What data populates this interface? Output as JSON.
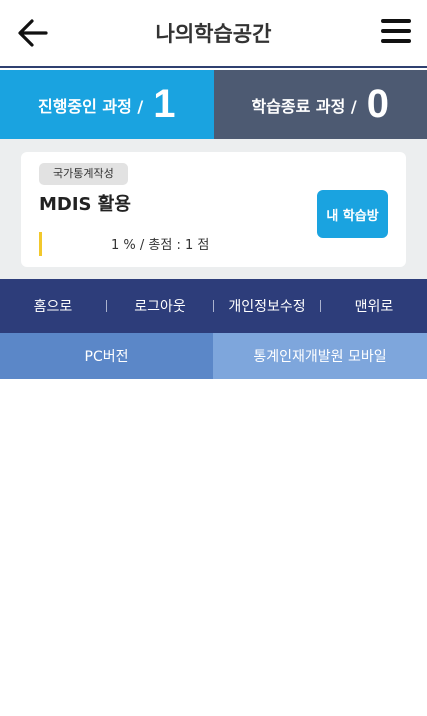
{
  "header": {
    "title": "나의학습공간",
    "back_icon": "arrow-left-icon",
    "menu_icon": "hamburger-menu-icon"
  },
  "stats": {
    "in_progress_label": "진행중인 과정 /",
    "in_progress_count": "1",
    "completed_label": "학습종료 과정 /",
    "completed_count": "0",
    "colors": {
      "in_progress": "#1aa3e0",
      "completed": "#4d5a72"
    }
  },
  "course": {
    "tag": "국가통계작성",
    "name": "MDIS 활용",
    "progress_text": "1 % / 총점 : 1 점",
    "progress_percent": 1,
    "study_button": "내 학습방"
  },
  "nav": {
    "items": [
      "홈으로",
      "로그아웃",
      "개인정보수정",
      "맨위로"
    ]
  },
  "links": {
    "pc": "PC버전",
    "mobile": "통계인재개발원 모바일"
  }
}
